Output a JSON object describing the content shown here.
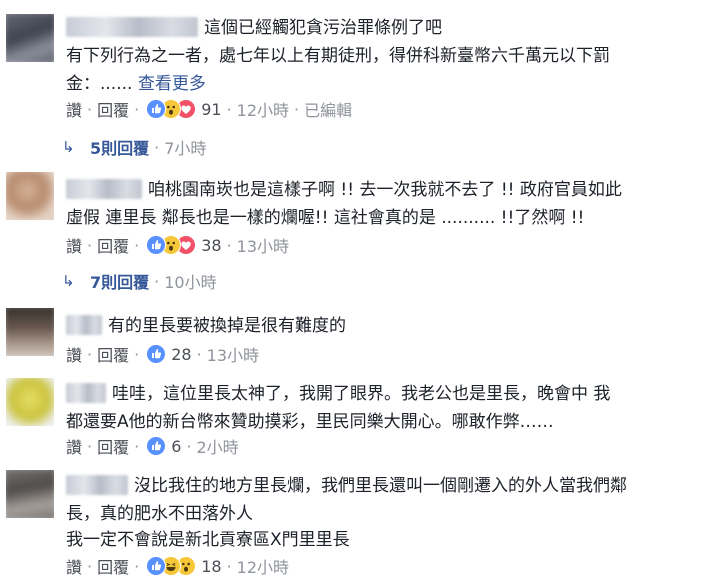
{
  "comments": [
    {
      "text": "這個已經觸犯貪污治罪條例了吧",
      "text2": "有下列行為之一者，處七年以上有期徒刑，得併科新臺幣六千萬元以下罰",
      "text3": "金：...... ",
      "see_more": "查看更多",
      "like": "讚",
      "reply": "回覆",
      "reactions": [
        "like-icon",
        "wow-icon",
        "love-icon"
      ],
      "count": "91",
      "time": "12小時",
      "edited": "已編輯",
      "replies_label": "5則回覆",
      "replies_time": "7小時"
    },
    {
      "text": "咱桃園南崁也是這樣子啊 !! 去一次我就不去了 !! 政府官員如此",
      "text2": "虛假 連里長 鄰長也是一樣的爛喔!! 這社會真的是 .......... !!了然啊 !!",
      "like": "讚",
      "reply": "回覆",
      "reactions": [
        "like-icon",
        "wow-icon",
        "love-icon"
      ],
      "count": "38",
      "time": "13小時",
      "replies_label": "7則回覆",
      "replies_time": "10小時"
    },
    {
      "text": "有的里長要被換掉是很有難度的",
      "like": "讚",
      "reply": "回覆",
      "reactions": [
        "like-icon"
      ],
      "count": "28",
      "time": "13小時"
    },
    {
      "text": "哇哇，這位里長太神了，我開了眼界。我老公也是里長，晚會中 我",
      "text2": "都還要A他的新台幣來贊助摸彩，里民同樂大開心。哪敢作弊……",
      "like": "讚",
      "reply": "回覆",
      "reactions": [
        "like-icon"
      ],
      "count": "6",
      "time": "2小時"
    },
    {
      "text": "沒比我住的地方里長爛，我們里長還叫一個剛遷入的外人當我們鄰",
      "text2": "長，真的肥水不田落外人",
      "text3": "我一定不會說是新北貢寮區X門里里長",
      "like": "讚",
      "reply": "回覆",
      "reactions": [
        "like-icon",
        "haha-icon",
        "wow-icon"
      ],
      "count": "18",
      "time": "12小時"
    }
  ],
  "colors": {
    "link": "#365899",
    "meta": "#90949c",
    "text": "#1d2129",
    "like": "#5890ff",
    "love": "#f25268",
    "wow": "#f7c73a"
  }
}
